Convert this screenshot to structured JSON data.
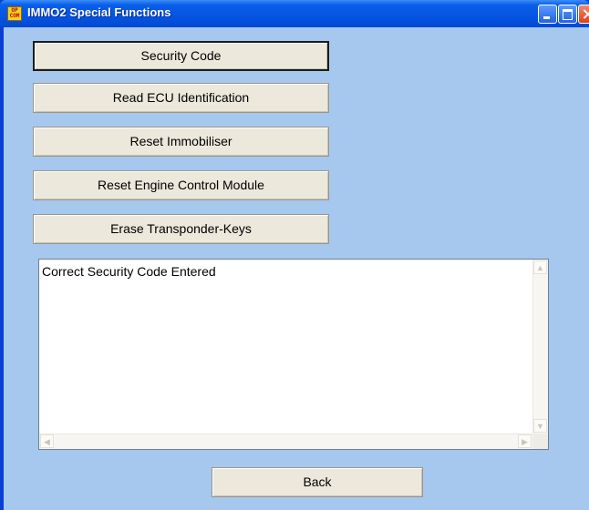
{
  "window": {
    "title": "IMMO2 Special Functions",
    "app_icon_text_top": "OP",
    "app_icon_text_bottom": "COM",
    "controls": [
      "minimize",
      "maximize",
      "close"
    ]
  },
  "actions": [
    {
      "label": "Security Code",
      "focused": true
    },
    {
      "label": "Read ECU Identification",
      "focused": false
    },
    {
      "label": "Reset Immobiliser",
      "focused": false
    },
    {
      "label": "Reset Engine Control Module",
      "focused": false
    },
    {
      "label": "Erase Transponder-Keys",
      "focused": false
    }
  ],
  "output": {
    "text": "Correct Security Code Entered"
  },
  "footer": {
    "back_label": "Back"
  },
  "colors": {
    "titlebar": "#0554e2",
    "client_background": "#a6c8ef",
    "button_face": "#ece8dc"
  }
}
